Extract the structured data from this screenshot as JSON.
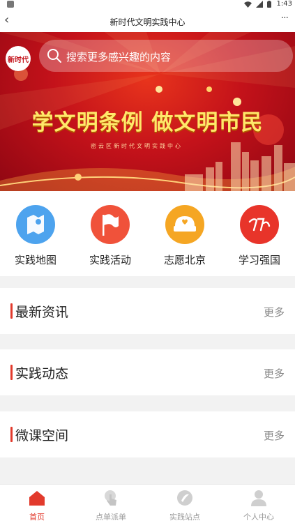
{
  "status_bar": {
    "time": "1:43"
  },
  "nav": {
    "title": "新时代文明实践中心",
    "back_glyph": "‹",
    "more_glyph": "···"
  },
  "banner": {
    "logo_text": "新时代",
    "search_placeholder": "搜索更多感兴趣的内容",
    "slogan": "学文明条例 做文明市民",
    "subslogan": "密云区新时代文明实践中心"
  },
  "quick_nav": [
    {
      "label": "实践地图",
      "icon": "map-icon",
      "color": "#4da3ee"
    },
    {
      "label": "实践活动",
      "icon": "flag-icon",
      "color": "#f0523a"
    },
    {
      "label": "志愿北京",
      "icon": "volunteer-icon",
      "color": "#f5a623"
    },
    {
      "label": "学习强国",
      "icon": "study-icon",
      "color": "#e8342a"
    }
  ],
  "sections": [
    {
      "title": "最新资讯",
      "more": "更多"
    },
    {
      "title": "实践动态",
      "more": "更多"
    },
    {
      "title": "微课空间",
      "more": "更多"
    }
  ],
  "tab_bar": [
    {
      "label": "首页",
      "icon": "home-icon",
      "active": true
    },
    {
      "label": "点单派单",
      "icon": "tap-icon",
      "active": false
    },
    {
      "label": "实践站点",
      "icon": "station-icon",
      "active": false
    },
    {
      "label": "个人中心",
      "icon": "person-icon",
      "active": false
    }
  ],
  "colors": {
    "accent": "#e23a2c",
    "banner_red": "#c4121a",
    "slogan_yellow": "#ffe86a"
  }
}
